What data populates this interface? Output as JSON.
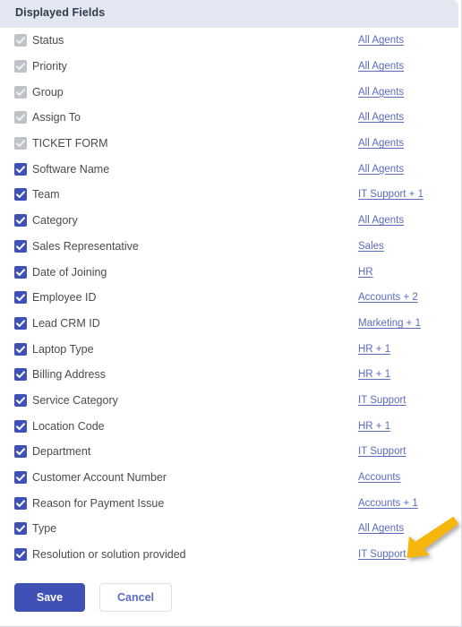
{
  "header": {
    "title": "Displayed Fields"
  },
  "fields": [
    {
      "label": "Status",
      "checked": true,
      "locked": true,
      "agents": "All Agents"
    },
    {
      "label": "Priority",
      "checked": true,
      "locked": true,
      "agents": "All Agents"
    },
    {
      "label": "Group",
      "checked": true,
      "locked": true,
      "agents": "All Agents"
    },
    {
      "label": "Assign To",
      "checked": true,
      "locked": true,
      "agents": "All Agents"
    },
    {
      "label": "TICKET FORM",
      "checked": true,
      "locked": true,
      "agents": "All Agents"
    },
    {
      "label": "Software Name",
      "checked": true,
      "locked": false,
      "agents": "All Agents"
    },
    {
      "label": "Team",
      "checked": true,
      "locked": false,
      "agents": "IT Support + 1"
    },
    {
      "label": "Category",
      "checked": true,
      "locked": false,
      "agents": "All Agents"
    },
    {
      "label": "Sales Representative",
      "checked": true,
      "locked": false,
      "agents": "Sales"
    },
    {
      "label": "Date of Joining",
      "checked": true,
      "locked": false,
      "agents": "HR"
    },
    {
      "label": "Employee ID",
      "checked": true,
      "locked": false,
      "agents": "Accounts + 2"
    },
    {
      "label": "Lead CRM ID",
      "checked": true,
      "locked": false,
      "agents": "Marketing + 1"
    },
    {
      "label": "Laptop Type",
      "checked": true,
      "locked": false,
      "agents": "HR + 1"
    },
    {
      "label": "Billing Address",
      "checked": true,
      "locked": false,
      "agents": "HR + 1"
    },
    {
      "label": "Service Category",
      "checked": true,
      "locked": false,
      "agents": "IT Support"
    },
    {
      "label": "Location Code",
      "checked": true,
      "locked": false,
      "agents": "HR + 1"
    },
    {
      "label": "Department",
      "checked": true,
      "locked": false,
      "agents": "IT Support"
    },
    {
      "label": "Customer Account Number",
      "checked": true,
      "locked": false,
      "agents": "Accounts"
    },
    {
      "label": "Reason for Payment Issue",
      "checked": true,
      "locked": false,
      "agents": "Accounts + 1"
    },
    {
      "label": "Type",
      "checked": true,
      "locked": false,
      "agents": "All Agents"
    },
    {
      "label": "Resolution or solution provided",
      "checked": true,
      "locked": false,
      "agents": "IT Support"
    }
  ],
  "footer": {
    "save_label": "Save",
    "cancel_label": "Cancel"
  },
  "annotation": {
    "icon": "arrow-down-left-icon",
    "color": "#F5B70F"
  },
  "colors": {
    "header_bg": "#e3e7f1",
    "checkbox_on": "#3f51b5",
    "checkbox_off": "#bfc2c7",
    "link": "#5c6bc0",
    "primary_button": "#3f51b5"
  }
}
